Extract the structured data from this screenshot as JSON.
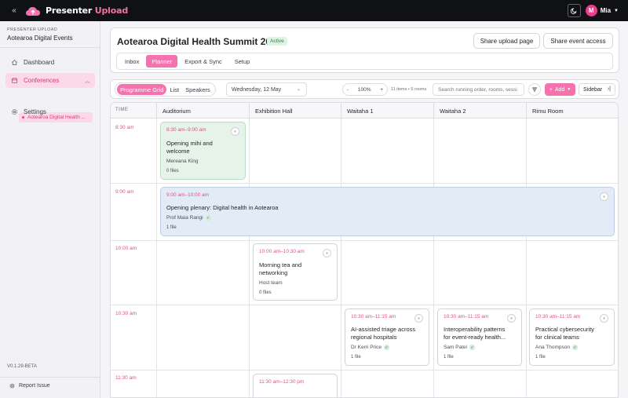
{
  "topbar": {
    "brand_main": "Presenter",
    "brand_accent": "Upload",
    "user_initial": "M",
    "user_name": "Mia",
    "icons": [
      "collapse-sidebar-icon",
      "cloud-logo-icon",
      "moon-icon",
      "chevron-down-icon"
    ]
  },
  "sidebar": {
    "org_caption": "PRESENTER UPLOAD",
    "org_name": "Aotearoa Digital Events",
    "items": [
      {
        "label": "Dashboard",
        "icon": "home-icon"
      },
      {
        "label": "Conferences",
        "icon": "calendar-icon",
        "active": true
      },
      {
        "label": "Settings",
        "icon": "gear-icon"
      }
    ],
    "sub_item": "Aotearoa Digital Health ...",
    "version": "V0.1.29-BETA",
    "report": "Report Issue"
  },
  "header": {
    "title": "Aotearoa Digital Health Summit 2027",
    "status": "Active",
    "share_upload": "Share upload page",
    "share_access": "Share event access",
    "tabs": [
      "Inbox",
      "Planner",
      "Export & Sync",
      "Setup"
    ],
    "active_tab": "Planner"
  },
  "toolbar": {
    "views": [
      "Programme Grid",
      "List",
      "Speakers"
    ],
    "active_view": "Programme Grid",
    "date": "Wednesday, 12 May",
    "zoom_minus": "-",
    "zoom": "100%",
    "zoom_plus": "+",
    "counts": "11 items • 5 rooms",
    "search_placeholder": "Search running order, rooms, sessi",
    "add": "Add",
    "sidebar": "Sidebar"
  },
  "grid": {
    "time_header": "TIME",
    "rooms": [
      "Auditorium",
      "Exhibition Hall",
      "Waitaha 1",
      "Waitaha 2",
      "Rimu Room"
    ],
    "times": [
      "8:30 am",
      "9:00 am",
      "10:00 am",
      "10:30 am",
      "11:30 am"
    ],
    "sessions": [
      {
        "time": "8:30 am–9:00 am",
        "title_1": "Opening mihi and",
        "title_2": "welcome",
        "person": "Mereana King",
        "files": "0 files",
        "color": "#e5f3e8"
      },
      {
        "time": "9:00 am–10:00 am",
        "title_1": "Opening plenary: Digital health in Aotearoa",
        "title_2": "",
        "person": "Prof Maia Rangi",
        "files": "1 file",
        "color": "#e3ebf7"
      },
      {
        "time": "10:00 am–10:30 am",
        "title_1": "Morning tea and",
        "title_2": "networking",
        "person": "Host team",
        "files": "0 files"
      },
      {
        "time": "10:30 am–11:15 am",
        "title_1": "AI-assisted triage across",
        "title_2": "regional hospitals",
        "person": "Dr Kerri Price",
        "files": "1 file"
      },
      {
        "time": "10:30 am–11:15 am",
        "title_1": "Interoperability patterns",
        "title_2": "for event-ready health...",
        "person": "Sam Patel",
        "files": "1 file"
      },
      {
        "time": "10:30 am–11:15 am",
        "title_1": "Practical cybersecurity",
        "title_2": "for clinical teams",
        "person": "Ana Thompson",
        "files": "1 file"
      },
      {
        "time": "11:30 am–12:30 pm",
        "title_1": "",
        "title_2": "",
        "person": "",
        "files": ""
      }
    ]
  },
  "colors": {
    "accent": "#f472ad",
    "accent_text": "#e0508f",
    "topbar": "#0f1115"
  }
}
